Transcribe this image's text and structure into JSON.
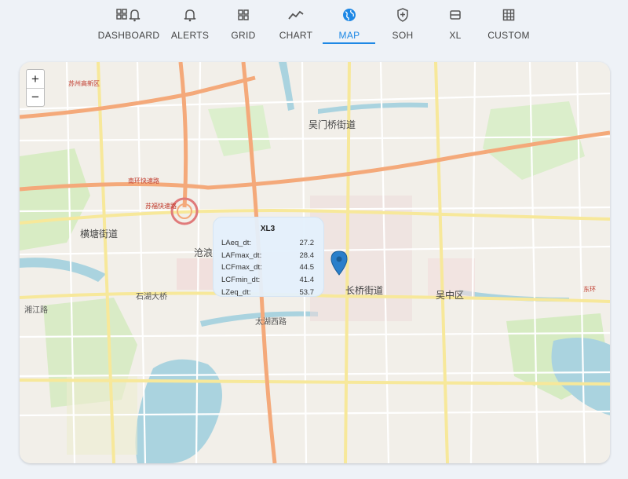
{
  "nav": {
    "tabs": [
      {
        "label": "DASHBOARD",
        "icon": "dashboard-bell-icon",
        "active": false
      },
      {
        "label": "ALERTS",
        "icon": "bell-icon",
        "active": false
      },
      {
        "label": "GRID",
        "icon": "grid-icon",
        "active": false
      },
      {
        "label": "CHART",
        "icon": "line-chart-icon",
        "active": false
      },
      {
        "label": "MAP",
        "icon": "globe-icon",
        "active": true
      },
      {
        "label": "SOH",
        "icon": "shield-icon",
        "active": false
      },
      {
        "label": "XL",
        "icon": "device-icon",
        "active": false
      },
      {
        "label": "CUSTOM",
        "icon": "table-icon",
        "active": false
      }
    ],
    "accent_color": "#1e88e5"
  },
  "map": {
    "zoom_in": "+",
    "zoom_out": "−",
    "labels": {
      "wumenqiao": "吴门桥街道",
      "hengtang": "横塘街道",
      "canglang": "沧浪",
      "changqiao": "长桥街道",
      "wuzhong": "吴中区",
      "suzhou_hitech": "苏州高新区",
      "shihu": "石湖大桥",
      "nanhuan": "南环快速路",
      "shifeng": "苏福快速路",
      "ring": "东环",
      "taihu": "太湖西路",
      "xiangjiang": "湘江路"
    },
    "popup": {
      "title": "XL3",
      "rows": [
        {
          "name": "LAeq_dt:",
          "value": "27.2"
        },
        {
          "name": "LAFmax_dt:",
          "value": "28.4"
        },
        {
          "name": "LCFmax_dt:",
          "value": "44.5"
        },
        {
          "name": "LCFmin_dt:",
          "value": "41.4"
        },
        {
          "name": "LZeq_dt:",
          "value": "53.7"
        }
      ]
    }
  }
}
